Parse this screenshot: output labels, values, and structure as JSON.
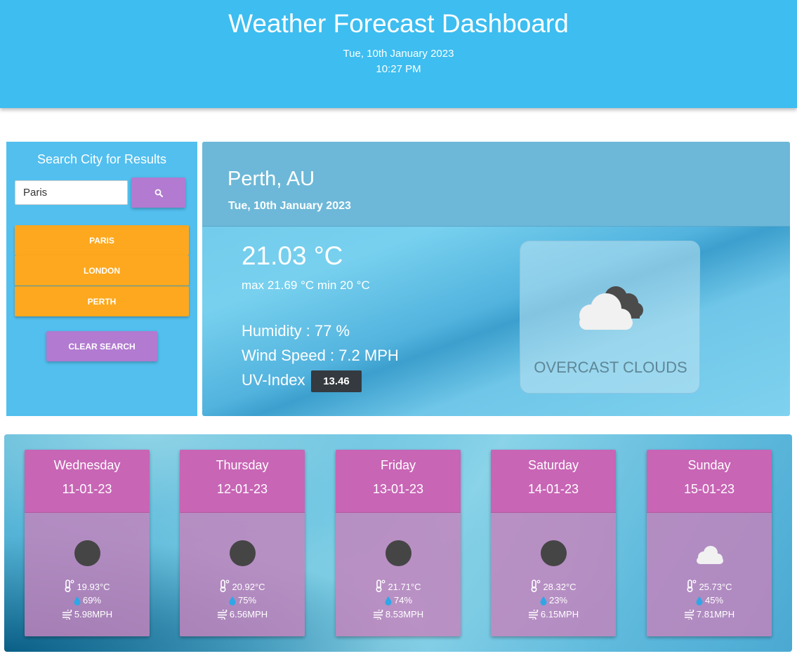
{
  "header": {
    "title": "Weather Forecast Dashboard",
    "date": "Tue, 10th January 2023",
    "time": "10:27 PM"
  },
  "search": {
    "heading": "Search City for Results",
    "input_value": "Paris",
    "button_icon": "search-icon",
    "history": [
      {
        "label": "PARIS"
      },
      {
        "label": "LONDON"
      },
      {
        "label": "PERTH"
      }
    ],
    "clear_label": "CLEAR SEARCH"
  },
  "current": {
    "city": "Perth, AU",
    "date": "Tue, 10th January 2023",
    "temp": "21.03 °C",
    "range": "max 21.69 °C min 20 °C",
    "humidity": "Humidity : 77 %",
    "wind": "Wind Speed : 7.2 MPH",
    "uv_label": "UV-Index",
    "uv_value": "13.46",
    "uv_badge_color": "#343a40",
    "condition": "OVERCAST CLOUDS",
    "condition_icon": "overcast-clouds-icon"
  },
  "forecast": [
    {
      "day": "Wednesday",
      "date": "11-01-23",
      "icon": "dark-disc-icon",
      "temp": "19.93°C",
      "humidity": "69%",
      "wind": "5.98MPH"
    },
    {
      "day": "Thursday",
      "date": "12-01-23",
      "icon": "dark-disc-icon",
      "temp": "20.92°C",
      "humidity": "75%",
      "wind": "6.56MPH"
    },
    {
      "day": "Friday",
      "date": "13-01-23",
      "icon": "dark-disc-icon",
      "temp": "21.71°C",
      "humidity": "74%",
      "wind": "8.53MPH"
    },
    {
      "day": "Saturday",
      "date": "14-01-23",
      "icon": "dark-disc-icon",
      "temp": "28.32°C",
      "humidity": "23%",
      "wind": "6.15MPH"
    },
    {
      "day": "Sunday",
      "date": "15-01-23",
      "icon": "cloud-icon",
      "temp": "25.73°C",
      "humidity": "45%",
      "wind": "7.81MPH"
    }
  ],
  "colors": {
    "header": "#3dbdf0",
    "history_button": "#fda81e",
    "accent_button": "#b27ad0",
    "forecast_header": "#c865b5"
  }
}
